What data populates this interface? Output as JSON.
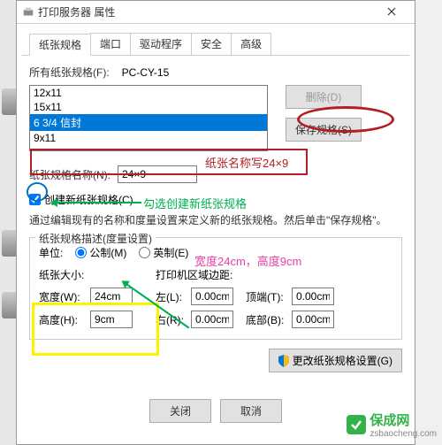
{
  "title": "打印服务器 属性",
  "tabs": [
    "纸张规格",
    "端口",
    "驱动程序",
    "安全",
    "高级"
  ],
  "allForms": {
    "label": "所有纸张规格(F):",
    "server": "PC-CY-15"
  },
  "listItems": [
    "12x11",
    "15x11",
    "6 3/4 信封",
    "9x11"
  ],
  "buttons": {
    "delete": "删除(D)",
    "save": "保存规格(S)",
    "changeSettings": "更改纸张规格设置(G)",
    "close": "关闭",
    "cancel": "取消"
  },
  "formName": {
    "label": "纸张规格名称(N):",
    "value": "24×9"
  },
  "createNew": {
    "label": "创建新纸张规格(C)"
  },
  "desc": "通过编辑现有的名称和度量设置来定义新的纸张规格。然后单击\"保存规格\"。",
  "groupTitle": "纸张规格描述(度量设置)",
  "units": {
    "label": "单位:",
    "metric": "公制(M)",
    "english": "英制(E)"
  },
  "sizeLabel": "纸张大小:",
  "marginLabel": "打印机区域边距:",
  "dims": {
    "width": {
      "label": "宽度(W):",
      "value": "24cm"
    },
    "height": {
      "label": "高度(H):",
      "value": "9cm"
    },
    "left": {
      "label": "左(L):",
      "value": "0.00cm"
    },
    "right": {
      "label": "右(R):",
      "value": "0.00cm"
    },
    "top": {
      "label": "顶端(T):",
      "value": "0.00cm"
    },
    "bottom": {
      "label": "底部(B):",
      "value": "0.00cm"
    }
  },
  "annotations": {
    "nameHint": "纸张名称写24×9",
    "createHint": "勾选创建新纸张规格",
    "sizeHint": "宽度24cm，高度9cm"
  },
  "watermark": {
    "name": "保成网",
    "url": "zsbaocheng.com"
  }
}
